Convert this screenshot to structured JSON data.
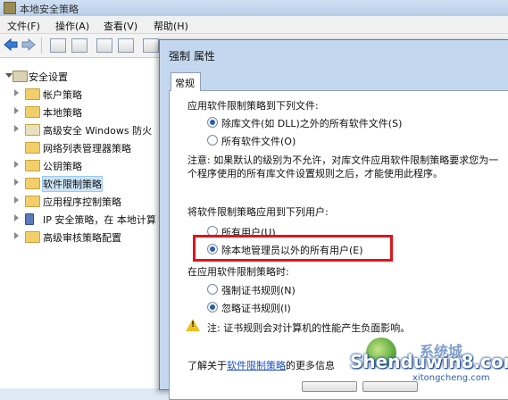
{
  "main_window": {
    "title": "本地安全策略",
    "menu": [
      "文件(F)",
      "操作(A)",
      "查看(V)",
      "帮助(H)"
    ]
  },
  "tree": {
    "root": "安全设置",
    "items": [
      {
        "label": "帐户策略",
        "expandable": true
      },
      {
        "label": "本地策略",
        "expandable": true
      },
      {
        "label": "高级安全 Windows 防火",
        "expandable": true
      },
      {
        "label": "网络列表管理器策略",
        "expandable": false
      },
      {
        "label": "公钥策略",
        "expandable": true
      },
      {
        "label": "软件限制策略",
        "expandable": true,
        "selected": true
      },
      {
        "label": "应用程序控制策略",
        "expandable": true
      },
      {
        "label": "IP 安全策略，在 本地计算",
        "expandable": true
      },
      {
        "label": "高级审核策略配置",
        "expandable": true
      }
    ]
  },
  "dialog": {
    "title": "强制 属性",
    "tab": "常规",
    "section1_label": "应用软件限制策略到下列文件:",
    "option_exclude_libs": "除库文件(如 DLL)之外的所有软件文件(S)",
    "option_all_files": "所有软件文件(O)",
    "note": "注意: 如果默认的级别为不允许，对库文件应用软件限制策略要求您为一个程序使用的所有库文件设置规则之后，才能使用此程序。",
    "section2_label": "将软件限制策略应用到下列用户:",
    "option_all_users": "所有用户(U)",
    "option_except_admins": "除本地管理员以外的所有用户(E)",
    "section3_label": "在应用软件限制策略时:",
    "option_enforce_cert": "强制证书规则(N)",
    "option_ignore_cert": "忽略证书规则(I)",
    "cert_note": "注: 证书规则会对计算机的性能产生负面影响。",
    "learn_prefix": "了解关于",
    "learn_link": "软件限制策略",
    "learn_suffix": "的更多信息",
    "selected_files_option": "exclude_libs",
    "selected_users_option": "except_admins",
    "selected_cert_option": "ignore_cert"
  },
  "watermark": {
    "brand": "Shenduwin8.com",
    "sub": "xitongcheng.com",
    "top": "系统城"
  },
  "colors": {
    "highlight_box": "#e0151b",
    "link": "#1a4dbf",
    "dialog_frame": "#c3d7ee"
  }
}
